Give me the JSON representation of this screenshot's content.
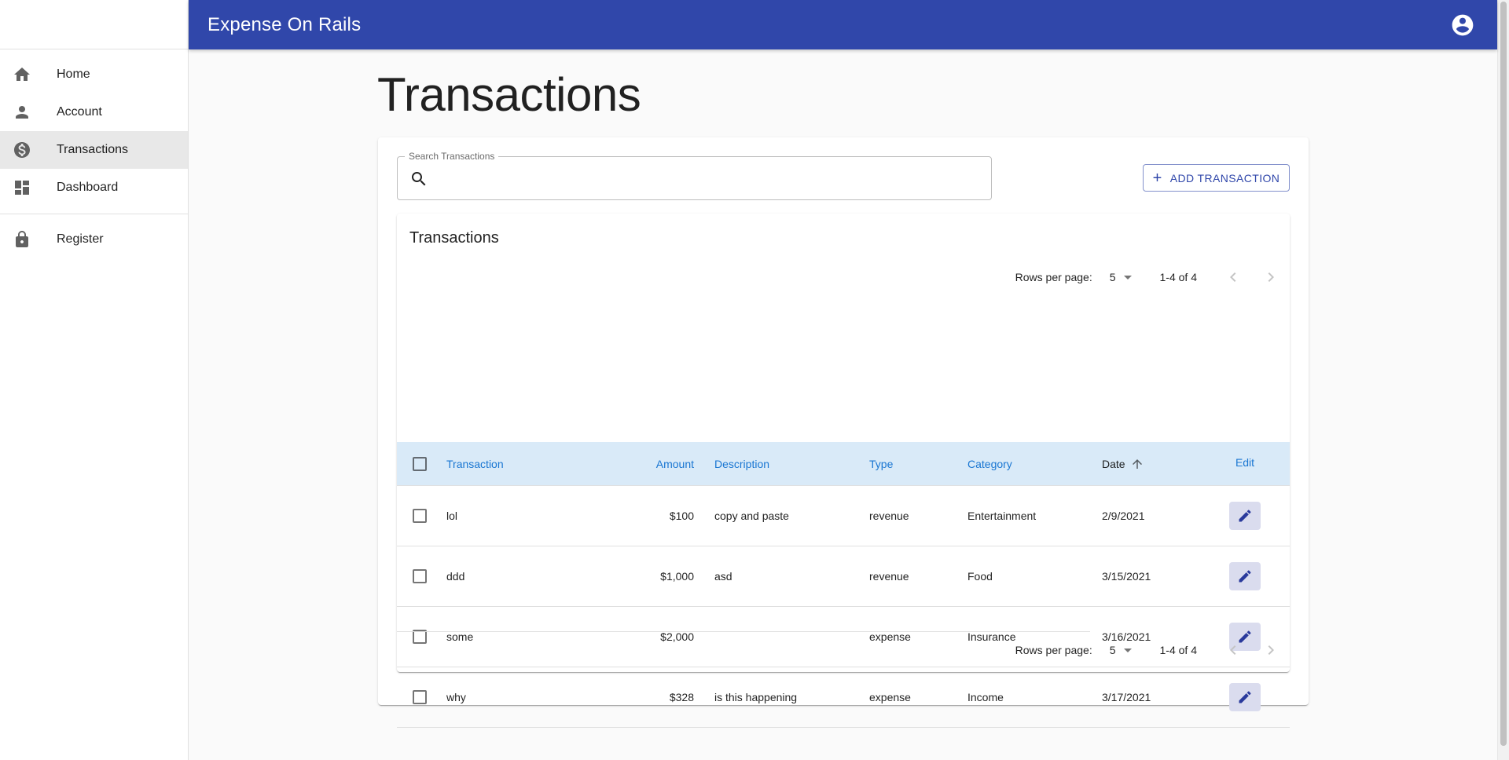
{
  "app": {
    "title": "Expense On Rails",
    "account_icon": "account-circle-icon"
  },
  "sidebar": {
    "items": [
      {
        "label": "Home",
        "icon": "home-icon",
        "active": false
      },
      {
        "label": "Account",
        "icon": "person-icon",
        "active": false
      },
      {
        "label": "Transactions",
        "icon": "dollar-circle-icon",
        "active": true
      },
      {
        "label": "Dashboard",
        "icon": "dashboard-icon",
        "active": false
      }
    ],
    "secondary_items": [
      {
        "label": "Register",
        "icon": "lock-icon"
      }
    ]
  },
  "page": {
    "title": "Transactions"
  },
  "search": {
    "label": "Search Transactions",
    "value": "",
    "placeholder": ""
  },
  "toolbar": {
    "add_label": "ADD TRANSACTION"
  },
  "table": {
    "title": "Transactions",
    "pagination": {
      "rows_per_page_label": "Rows per page:",
      "rows_per_page": "5",
      "range": "1-4 of 4"
    },
    "columns": {
      "transaction": "Transaction",
      "amount": "Amount",
      "description": "Description",
      "type": "Type",
      "category": "Category",
      "date": "Date",
      "edit": "Edit"
    },
    "sort": {
      "column": "date",
      "direction": "asc"
    },
    "rows": [
      {
        "transaction": "lol",
        "amount": "$100",
        "description": "copy and paste",
        "type": "revenue",
        "category": "Entertainment",
        "date": "2/9/2021"
      },
      {
        "transaction": "ddd",
        "amount": "$1,000",
        "description": "asd",
        "type": "revenue",
        "category": "Food",
        "date": "3/15/2021"
      },
      {
        "transaction": "some",
        "amount": "$2,000",
        "description": "",
        "type": "expense",
        "category": "Insurance",
        "date": "3/16/2021"
      },
      {
        "transaction": "why",
        "amount": "$328",
        "description": "is this happening",
        "type": "expense",
        "category": "Income",
        "date": "3/17/2021"
      }
    ]
  },
  "colors": {
    "appbar": "#3047aa",
    "header_row": "#d9eaf8",
    "header_text": "#1976d2",
    "edit_button_bg": "#dadcee"
  }
}
